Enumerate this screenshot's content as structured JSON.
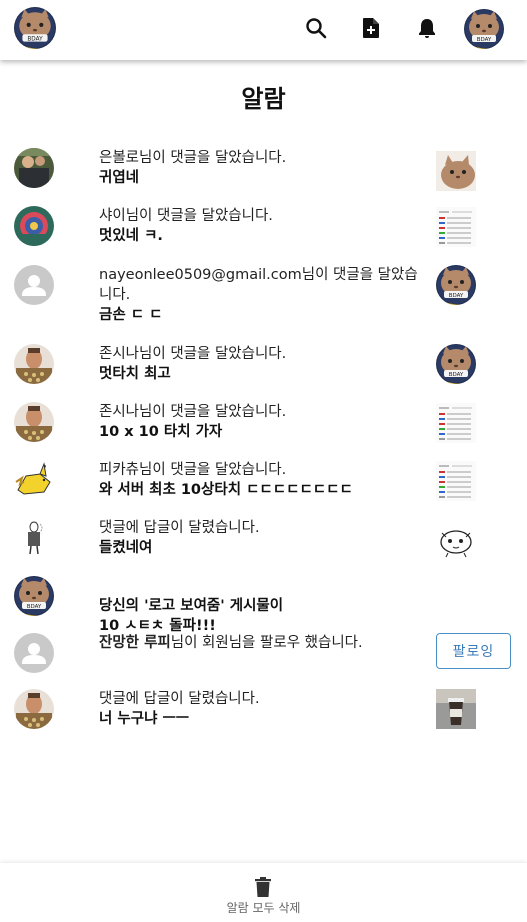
{
  "header": {
    "logo_icon": "cat-logo-icon",
    "icons": [
      "search-icon",
      "add-post-icon",
      "bell-icon"
    ],
    "profile_avatar": "cat-avatar-icon"
  },
  "page": {
    "title": "알람"
  },
  "notifications": [
    {
      "sender": "은볼로",
      "message": "님이 댓글을 달았습니다.",
      "comment": "귀엽네",
      "avatar": "photo-avatar-icon",
      "thumb": "cat-thumb-icon"
    },
    {
      "sender": "샤이",
      "message": "님이 댓글을 달았습니다.",
      "comment": "멋있네 ㅋ.",
      "avatar": "colorful-avatar-icon",
      "thumb": "document-thumb-icon"
    },
    {
      "sender": "nayeonlee0509@gmail.com",
      "message": "님이 댓글을 달았습니다.",
      "comment": "금손 ㄷ ㄷ",
      "avatar": "default-user-icon",
      "thumb": "cat-avatar-thumb-icon"
    },
    {
      "sender": "존시나",
      "message": "님이 댓글을 달았습니다.",
      "comment": "멋타치 최고",
      "avatar": "wrestler-avatar-icon",
      "thumb": "cat-avatar-thumb-icon"
    },
    {
      "sender": "존시나",
      "message": "님이 댓글을 달았습니다.",
      "comment": "10 x 10 타치 가자",
      "avatar": "wrestler-avatar-icon",
      "thumb": "document-thumb-icon"
    },
    {
      "sender": "피카츄",
      "message": "님이 댓글을 달았습니다.",
      "comment": "와 서버 최초 10상타치 ㄷㄷㄷㄷㄷㄷㄷㄷ",
      "avatar": "pikachu-avatar-icon",
      "thumb": "document-thumb-icon"
    },
    {
      "sender": "",
      "message": "댓글에 답글이 달렸습니다.",
      "comment": "들켰네여",
      "avatar": "sketch-avatar-icon",
      "thumb": "doodle-thumb-icon"
    },
    {
      "sender": "",
      "message": "",
      "comment": "당신의 '로고 보여줌' 게시물이\n10 ㅅㅌㅊ 돌파!!!",
      "avatar": "cat-logo-icon",
      "thumb": ""
    },
    {
      "sender": "잔망한 루피",
      "message": "님이 회원님을 팔로우 했습니다.",
      "comment": "",
      "avatar": "default-user-icon",
      "follow_label": "팔로잉"
    },
    {
      "sender": "",
      "message": "댓글에 답글이 달렸습니다.",
      "comment": "너 누구냐 ㅡㅡ",
      "avatar": "wrestler-avatar-icon",
      "thumb": "coffee-thumb-icon"
    }
  ],
  "footer": {
    "delete_all_label": "알람 모두 삭제",
    "icon": "trash-icon"
  }
}
